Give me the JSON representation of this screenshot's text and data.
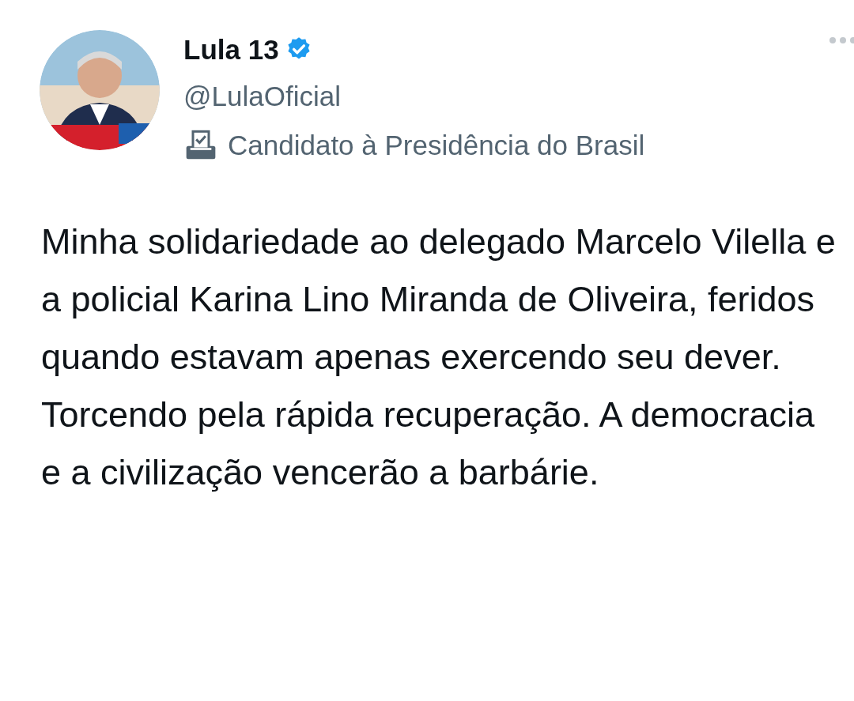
{
  "author": {
    "name": "Lula 13",
    "verified": true,
    "handle": "@LulaOficial",
    "bio": "Candidato à Presidência do Brasil"
  },
  "text": "Minha solidariedade ao delegado Marcelo Vilella e a policial Karina Lino Miranda de Oliveira, feridos quando estavam apenas exercendo seu dever. Torcendo pela rápida recuperação. A democracia e a civilização vencerão a barbárie."
}
